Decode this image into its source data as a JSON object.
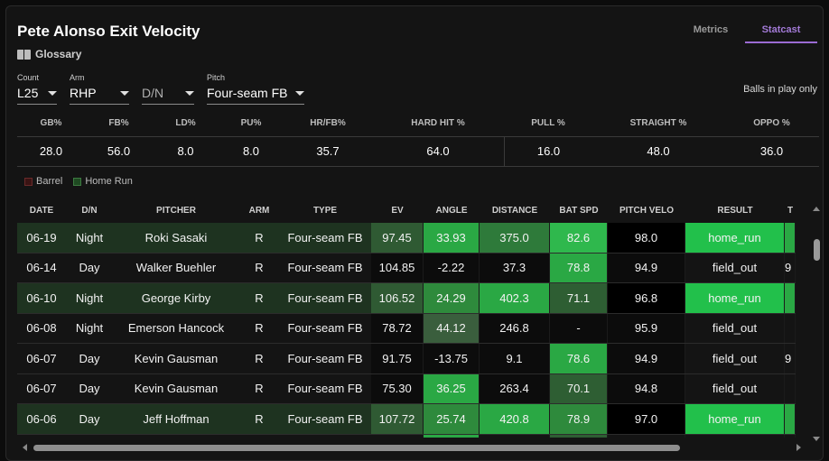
{
  "title": "Pete Alonso Exit Velocity",
  "glossary_label": "Glossary",
  "tabs": [
    {
      "label": "Metrics",
      "active": false
    },
    {
      "label": "Statcast",
      "active": true
    }
  ],
  "filters": [
    {
      "label": "Count",
      "value": "L25"
    },
    {
      "label": "Arm",
      "value": "RHP"
    },
    {
      "label": "",
      "value": "D/N"
    },
    {
      "label": "Pitch",
      "value": "Four-seam FB"
    }
  ],
  "balls_in_play_note": "Balls in play only",
  "summary": {
    "headers": [
      "GB%",
      "FB%",
      "LD%",
      "PU%",
      "HR/FB%",
      "HARD HIT %",
      "PULL %",
      "STRAIGHT %",
      "OPPO %"
    ],
    "values": [
      "28.0",
      "56.0",
      "8.0",
      "8.0",
      "35.7",
      "64.0",
      "16.0",
      "48.0",
      "36.0"
    ]
  },
  "legend": [
    {
      "name": "barrel",
      "label": "Barrel"
    },
    {
      "name": "home-run",
      "label": "Home Run"
    }
  ],
  "table": {
    "headers": [
      "DATE",
      "D/N",
      "PITCHER",
      "ARM",
      "TYPE",
      "EV",
      "ANGLE",
      "DISTANCE",
      "BAT SPD",
      "PITCH VELO",
      "RESULT",
      "T"
    ],
    "rows": [
      {
        "cells": [
          "06-19",
          "Night",
          "Roki Sasaki",
          "R",
          "Four-seam FB",
          "97.45",
          "33.93",
          "375.0",
          "82.6",
          "98.0",
          "home_run",
          ""
        ],
        "hr": true,
        "colors": {
          "5": "#2f5a33",
          "6": "#2aa844",
          "7": "#2e7a3a",
          "8": "#2fb84d",
          "9": "#000000",
          "10": "#22c04b",
          "11": "#2aa844"
        }
      },
      {
        "cells": [
          "06-14",
          "Day",
          "Walker Buehler",
          "R",
          "Four-seam FB",
          "104.85",
          "-2.22",
          "37.3",
          "78.8",
          "94.9",
          "field_out",
          "9"
        ],
        "hr": false,
        "colors": {
          "5": "#0c0c0c",
          "6": "#0c0c0c",
          "7": "#0c0c0c",
          "8": "#2aa844",
          "9": "#0c0c0c"
        }
      },
      {
        "cells": [
          "06-10",
          "Night",
          "George Kirby",
          "R",
          "Four-seam FB",
          "106.52",
          "24.29",
          "402.3",
          "71.1",
          "96.8",
          "home_run",
          ""
        ],
        "hr": true,
        "colors": {
          "5": "#2f5a33",
          "6": "#2e8a3c",
          "7": "#2aa844",
          "8": "#2e5e33",
          "9": "#000000",
          "10": "#22c04b",
          "11": "#2aa844"
        }
      },
      {
        "cells": [
          "06-08",
          "Night",
          "Emerson Hancock",
          "R",
          "Four-seam FB",
          "78.72",
          "44.12",
          "246.8",
          "-",
          "95.9",
          "field_out",
          ""
        ],
        "hr": false,
        "colors": {
          "5": "#0c0c0c",
          "6": "#3a5e3d",
          "7": "#0c0c0c",
          "8": "#0c0c0c",
          "9": "#0c0c0c"
        }
      },
      {
        "cells": [
          "06-07",
          "Day",
          "Kevin Gausman",
          "R",
          "Four-seam FB",
          "91.75",
          "-13.75",
          "9.1",
          "78.6",
          "94.9",
          "field_out",
          "9"
        ],
        "hr": false,
        "colors": {
          "5": "#0c0c0c",
          "6": "#0c0c0c",
          "7": "#0c0c0c",
          "8": "#2aa844",
          "9": "#0c0c0c"
        }
      },
      {
        "cells": [
          "06-07",
          "Day",
          "Kevin Gausman",
          "R",
          "Four-seam FB",
          "75.30",
          "36.25",
          "263.4",
          "70.1",
          "94.8",
          "field_out",
          ""
        ],
        "hr": false,
        "colors": {
          "5": "#0c0c0c",
          "6": "#2aa844",
          "7": "#0c0c0c",
          "8": "#2e5e33",
          "9": "#0c0c0c"
        }
      },
      {
        "cells": [
          "06-06",
          "Day",
          "Jeff Hoffman",
          "R",
          "Four-seam FB",
          "107.72",
          "25.74",
          "420.8",
          "78.9",
          "97.0",
          "home_run",
          ""
        ],
        "hr": true,
        "colors": {
          "5": "#2f5a33",
          "6": "#2e8a3c",
          "7": "#2aa844",
          "8": "#2e8a3c",
          "9": "#000000",
          "10": "#22c04b",
          "11": "#2aa844"
        }
      },
      {
        "cells": [
          "",
          "",
          "",
          "",
          "",
          "",
          "",
          "",
          "",
          "",
          "",
          ""
        ],
        "hr": false,
        "colors": {
          "6": "#2aa844",
          "8": "#2e5e33"
        }
      }
    ]
  }
}
